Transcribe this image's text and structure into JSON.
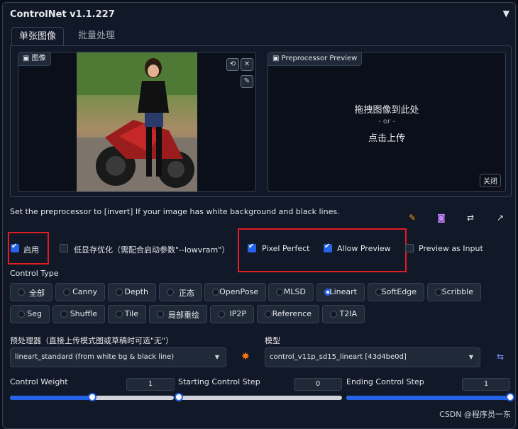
{
  "panel": {
    "title": "ControlNet v1.1.227",
    "collapse_glyph": "▼"
  },
  "tabs": [
    {
      "label": "单张图像",
      "active": true
    },
    {
      "label": "批量处理",
      "active": false
    }
  ],
  "image_box": {
    "label": "图像",
    "image_glyph": "▣"
  },
  "preview_box": {
    "label": "Preprocessor Preview",
    "drop_line1": "拖拽图像到此处",
    "drop_line2": "- or -",
    "drop_line3": "点击上传",
    "close_label": "关闭"
  },
  "hint": "Set the preprocessor to [invert] If your image has white background and black lines.",
  "checkboxes": {
    "enable": {
      "label": "启用",
      "checked": true
    },
    "low_vram": {
      "label": "低显存优化（需配合启动参数\"--lowvram\"）",
      "checked": false
    },
    "pixel_perfect": {
      "label": "Pixel Perfect",
      "checked": true
    },
    "allow_preview": {
      "label": "Allow Preview",
      "checked": true
    },
    "preview_as_input": {
      "label": "Preview as Input",
      "checked": false
    }
  },
  "control_type": {
    "label": "Control Type",
    "selected": "Lineart",
    "options": [
      "全部",
      "Canny",
      "Depth",
      "正态",
      "OpenPose",
      "MLSD",
      "Lineart",
      "SoftEdge",
      "Scribble",
      "Seg",
      "Shuffle",
      "Tile",
      "局部重绘",
      "IP2P",
      "Reference",
      "T2IA"
    ]
  },
  "preprocessor": {
    "label": "预处理器（直接上传模式图或草稿时可选\"无\"）",
    "value": "lineart_standard (from white bg & black line)"
  },
  "model": {
    "label": "模型",
    "value": "control_v11p_sd15_lineart [43d4be0d]"
  },
  "sliders": {
    "control_weight": {
      "label": "Control Weight",
      "value": "1",
      "fraction": 0.5
    },
    "starting_step": {
      "label": "Starting Control Step",
      "value": "0",
      "fraction": 0.0
    },
    "ending_step": {
      "label": "Ending Control Step",
      "value": "1",
      "fraction": 1.0
    }
  },
  "watermark": "CSDN @程序员一东",
  "colors": {
    "accent": "#2563eb",
    "highlight_box": "#e11d24",
    "background": "#0b0f19"
  },
  "icons": [
    "refresh-icon",
    "close-icon",
    "brush-icon",
    "edit-icon",
    "camera-icon",
    "swap-icon",
    "send-icon",
    "explode-icon",
    "refresh-model-icon"
  ]
}
